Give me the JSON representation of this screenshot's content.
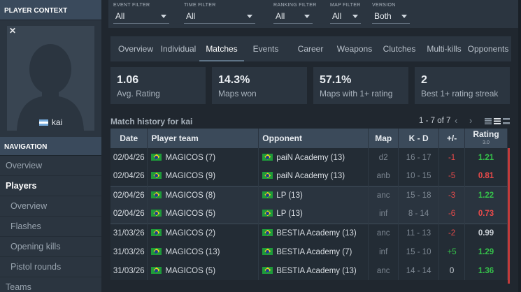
{
  "sidebar": {
    "context_header": "PLAYER CONTEXT",
    "player_name": "kai",
    "close_icon": "close-icon",
    "nav_header": "NAVIGATION",
    "nav_items": [
      {
        "label": "Overview",
        "level": 0,
        "active": false
      },
      {
        "label": "Players",
        "level": 0,
        "active": true
      },
      {
        "label": "Overview",
        "level": 1,
        "active": false
      },
      {
        "label": "Flashes",
        "level": 1,
        "active": false
      },
      {
        "label": "Opening kills",
        "level": 1,
        "active": false
      },
      {
        "label": "Pistol rounds",
        "level": 1,
        "active": false
      },
      {
        "label": "Teams",
        "level": 0,
        "active": false
      }
    ]
  },
  "filters": [
    {
      "label": "EVENT FILTER",
      "value": "All"
    },
    {
      "label": "TIME FILTER",
      "value": "All"
    },
    {
      "label": "RANKING FILTER",
      "value": "All"
    },
    {
      "label": "MAP FILTER",
      "value": "All"
    },
    {
      "label": "VERSION",
      "value": "Both"
    }
  ],
  "tabs": [
    "Overview",
    "Individual",
    "Matches",
    "Events",
    "Career",
    "Weapons",
    "Clutches",
    "Multi-kills",
    "Opponents"
  ],
  "active_tab": "Matches",
  "stats": [
    {
      "value": "1.06",
      "label": "Avg. Rating"
    },
    {
      "value": "14.3%",
      "label": "Maps won"
    },
    {
      "value": "57.1%",
      "label": "Maps with 1+ rating"
    },
    {
      "value": "2",
      "label": "Best 1+ rating streak"
    }
  ],
  "match_history": {
    "title": "Match history for kai",
    "pager": "1 - 7 of 7",
    "prev_icon": "chevron-left-icon",
    "next_icon": "chevron-right-icon",
    "columns": {
      "date": "Date",
      "team": "Player team",
      "opponent": "Opponent",
      "map": "Map",
      "kd": "K - D",
      "diff": "+/-",
      "rating": "Rating",
      "rating_sub": "3.0"
    },
    "rows": [
      {
        "date": "02/04/26",
        "team": "MAGICOS (7)",
        "opponent": "paiN Academy (13)",
        "map": "d2",
        "kd": "16 - 17",
        "diff": "-1",
        "rating": "1.21"
      },
      {
        "date": "02/04/26",
        "team": "MAGICOS (9)",
        "opponent": "paiN Academy (13)",
        "map": "anb",
        "kd": "10 - 15",
        "diff": "-5",
        "rating": "0.81"
      },
      {
        "date": "02/04/26",
        "team": "MAGICOS (8)",
        "opponent": "LP (13)",
        "map": "anc",
        "kd": "15 - 18",
        "diff": "-3",
        "rating": "1.22"
      },
      {
        "date": "02/04/26",
        "team": "MAGICOS (5)",
        "opponent": "LP (13)",
        "map": "inf",
        "kd": "8 - 14",
        "diff": "-6",
        "rating": "0.73"
      },
      {
        "date": "31/03/26",
        "team": "MAGICOS (2)",
        "opponent": "BESTIA Academy (13)",
        "map": "anc",
        "kd": "11 - 13",
        "diff": "-2",
        "rating": "0.99"
      },
      {
        "date": "31/03/26",
        "team": "MAGICOS (13)",
        "opponent": "BESTIA Academy (7)",
        "map": "inf",
        "kd": "15 - 10",
        "diff": "+5",
        "rating": "1.29"
      },
      {
        "date": "31/03/26",
        "team": "MAGICOS (5)",
        "opponent": "BESTIA Academy (13)",
        "map": "anc",
        "kd": "14 - 14",
        "diff": "0",
        "rating": "1.36"
      }
    ]
  },
  "colors": {
    "positive": "#35c04a",
    "negative": "#e84a4a",
    "neutral": "#c9cfd5",
    "header_bg": "#3b4a5a"
  }
}
